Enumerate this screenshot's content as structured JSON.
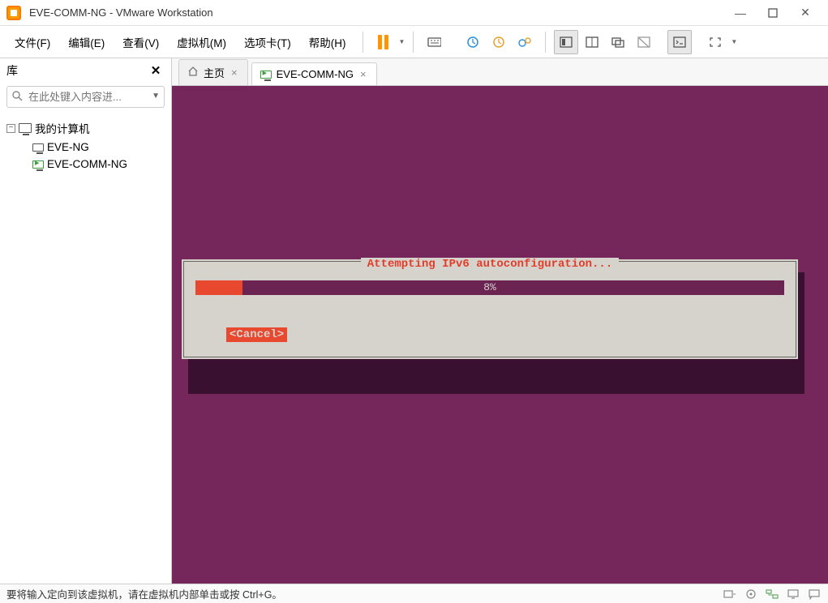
{
  "window": {
    "title": "EVE-COMM-NG - VMware Workstation"
  },
  "menu": {
    "file": "文件(F)",
    "edit": "编辑(E)",
    "view": "查看(V)",
    "vm": "虚拟机(M)",
    "tabs": "选项卡(T)",
    "help": "帮助(H)"
  },
  "sidebar": {
    "title": "库",
    "search_placeholder": "在此处键入内容进...",
    "tree": {
      "root": "我的计算机",
      "items": [
        "EVE-NG",
        "EVE-COMM-NG"
      ]
    }
  },
  "tabs": {
    "home": "主页",
    "vm": "EVE-COMM-NG"
  },
  "dialog": {
    "title": "Attempting IPv6 autoconfiguration...",
    "progress_percent": 8,
    "progress_text": "8%",
    "cancel": "<Cancel>"
  },
  "statusbar": {
    "text": "要将输入定向到该虚拟机，请在虚拟机内部单击或按 Ctrl+G。"
  }
}
